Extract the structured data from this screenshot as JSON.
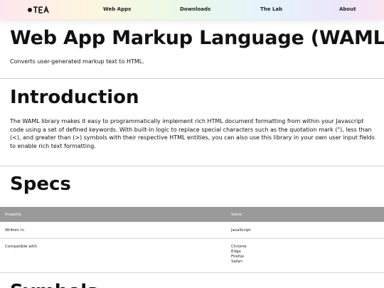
{
  "nav": {
    "logo_text": "JTEA",
    "items": [
      {
        "label": "Web Apps"
      },
      {
        "label": "Downloads"
      },
      {
        "label": "The Lab"
      },
      {
        "label": "About"
      }
    ]
  },
  "page": {
    "title": "Web App Markup Language (WAML)",
    "subtitle": "Converts user-generated markup text to HTML."
  },
  "intro": {
    "title": "Introduction",
    "text": "The WAML library makes it easy to programmatically implement rich HTML document formatting from within your Javascript code using a set of defined keywords. With built-in logic to replace special characters such as the quotation mark (\"), less than (<), and greater than (>) symbols with their respective HTML entities, you can also use this library in your own user input fields to enable rich text formatting."
  },
  "specs": {
    "title": "Specs",
    "headers": {
      "property": "Property",
      "value": "Value"
    },
    "rows": [
      {
        "property": "Written In",
        "values": [
          "JavaScript"
        ]
      },
      {
        "property": "Compatible with",
        "values": [
          "Chrome",
          "Edge",
          "Firefox",
          "Safari"
        ]
      }
    ]
  },
  "next_section": {
    "title": "Symbols"
  },
  "colors": {
    "table_header_bg": "#9a9a9a",
    "divider": "#cfcfcf"
  }
}
